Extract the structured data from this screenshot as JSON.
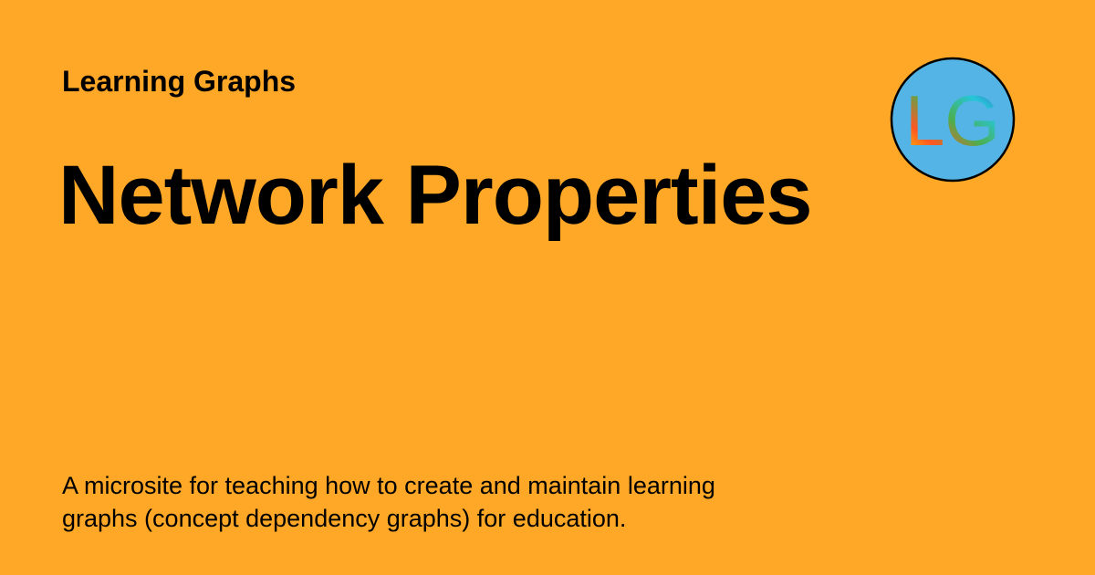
{
  "card": {
    "background_color": "#FFA726",
    "site_name": "Learning Graphs",
    "title": "Network Properties",
    "description": "A microsite for teaching how to create and maintain learning graphs (concept dependency graphs) for education.",
    "logo": {
      "text": "LG",
      "icon": "learning-graphs-logo",
      "circle_color": "#55B4E6",
      "border_color": "#000000"
    }
  }
}
